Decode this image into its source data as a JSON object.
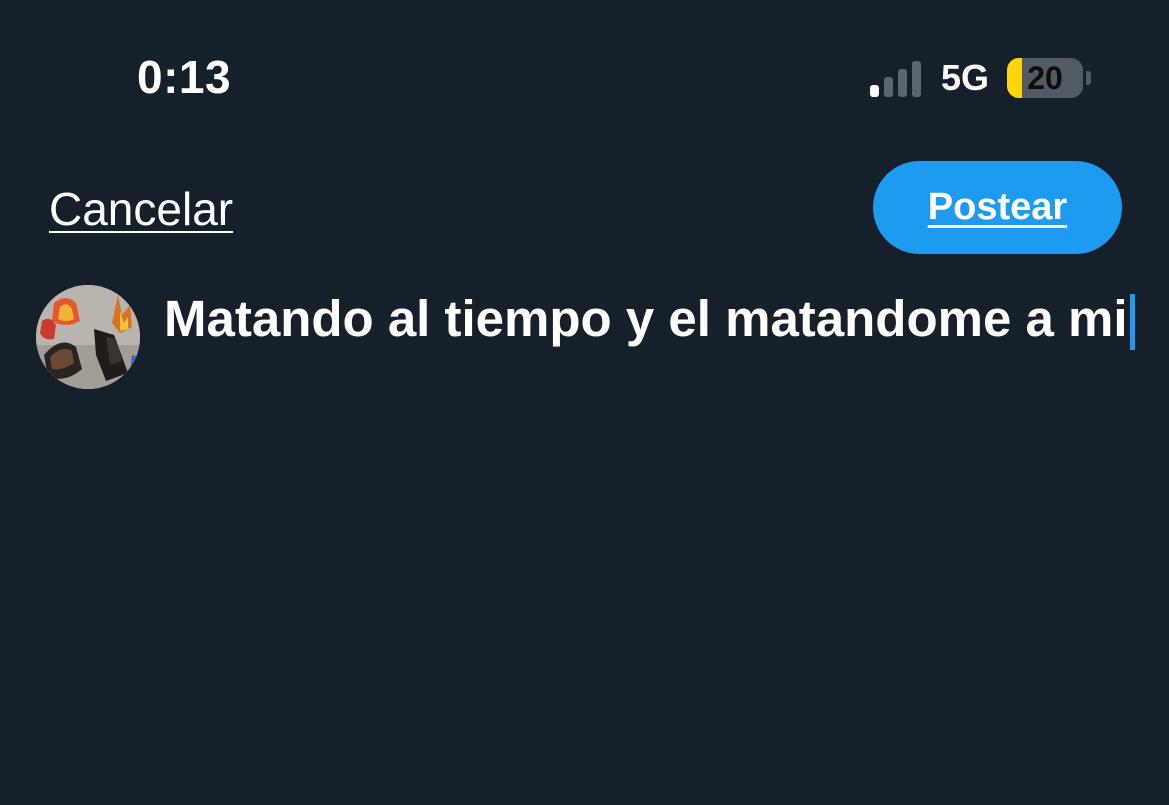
{
  "status_bar": {
    "time": "0:13",
    "network": "5G",
    "battery_level": "20",
    "battery_fraction": 0.2,
    "signal_bars_active": 1,
    "signal_bars_total": 4
  },
  "composer": {
    "cancel_label": "Cancelar",
    "post_label": "Postear",
    "text": "Matando al tiempo y el matandome a mi"
  },
  "colors": {
    "background": "#16202b",
    "accent": "#1d9bf0",
    "battery_low": "#ffd60a"
  },
  "icons": {
    "signal": "cellular-signal-icon",
    "battery": "battery-icon",
    "avatar": "user-avatar"
  }
}
